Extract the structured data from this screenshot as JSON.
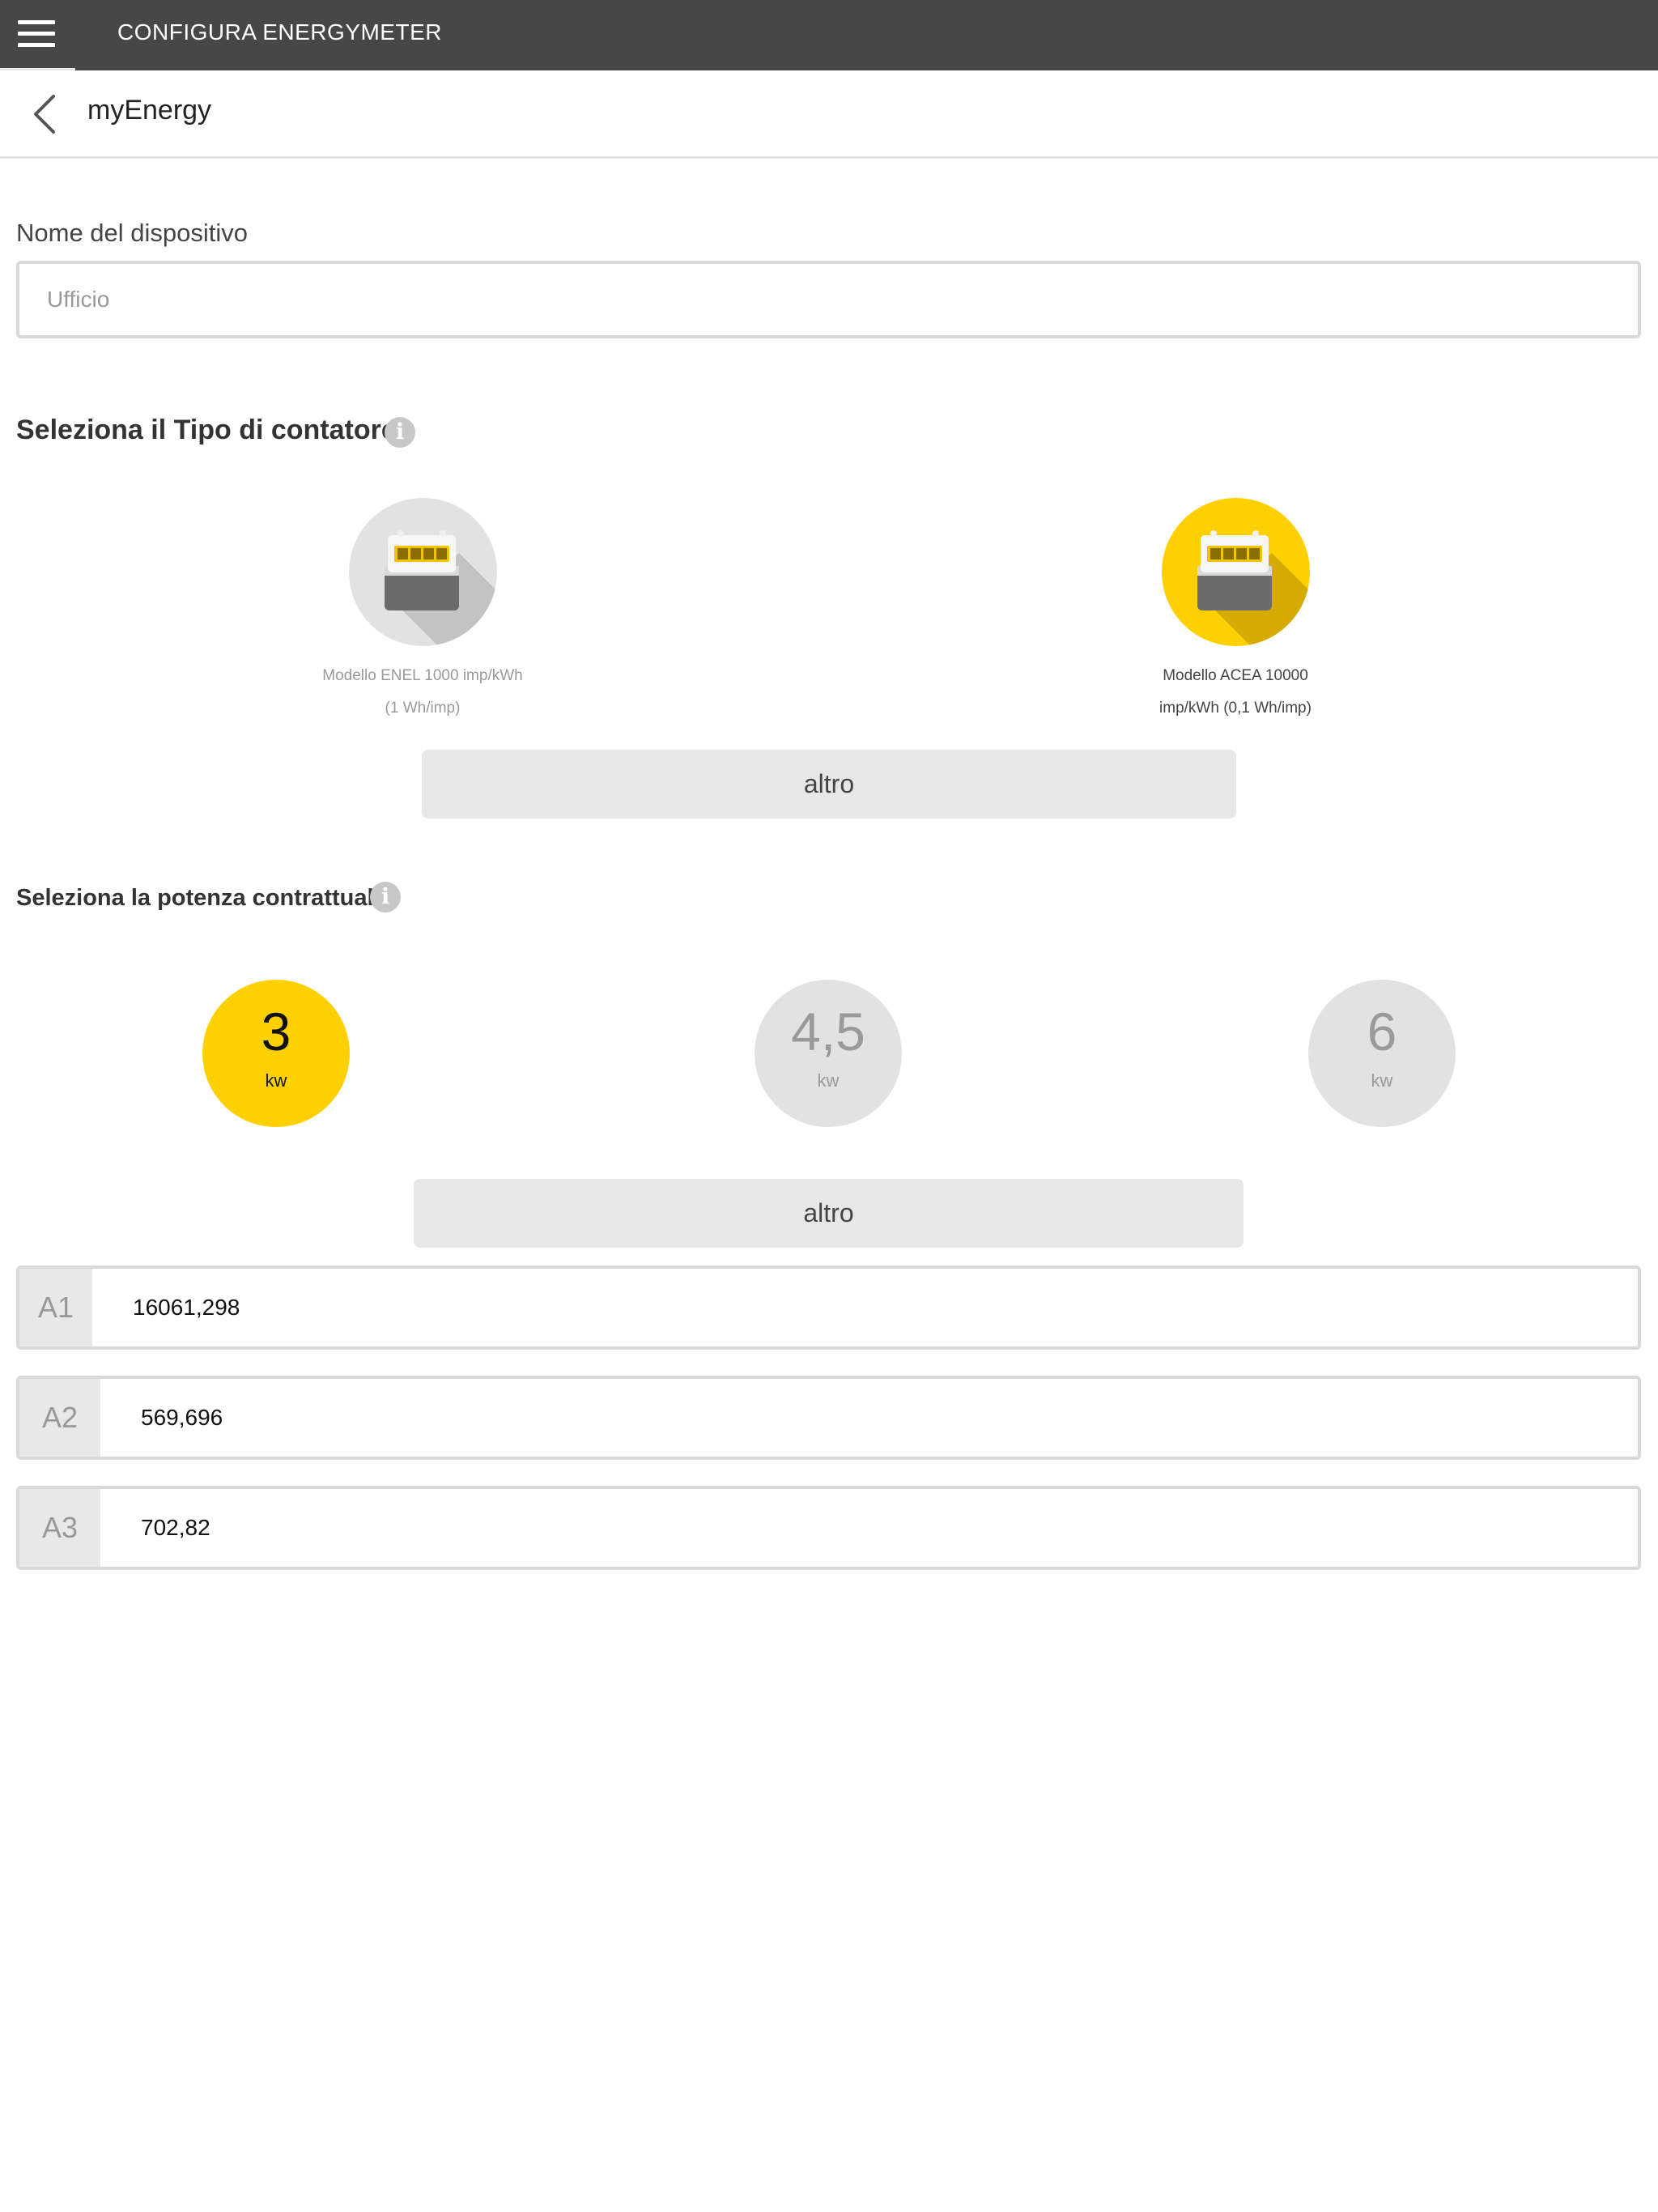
{
  "header": {
    "title": "CONFIGURA ENERGYMETER"
  },
  "subheader": {
    "title": "myEnergy"
  },
  "device": {
    "label": "Nome del dispositivo",
    "placeholder": "Ufficio",
    "value": ""
  },
  "meter_section": {
    "title": "Seleziona il Tipo di contatore",
    "options": [
      {
        "line1": "Modello ENEL 1000 imp/kWh",
        "line2": "(1 Wh/imp)",
        "selected": false,
        "digits": "2 3 5 6"
      },
      {
        "line1": "Modello ACEA 10000",
        "line2": "imp/kWh (0,1 Wh/imp)",
        "selected": true,
        "digits": "2 3 5 6"
      }
    ],
    "other_label": "altro"
  },
  "power_section": {
    "title": "Seleziona la potenza contrattuale",
    "options": [
      {
        "value": "3",
        "unit": "kw",
        "selected": true
      },
      {
        "value": "4,5",
        "unit": "kw",
        "selected": false
      },
      {
        "value": "6",
        "unit": "kw",
        "selected": false
      }
    ],
    "other_label": "altro"
  },
  "readings": [
    {
      "label": "A1",
      "value": "16061,298"
    },
    {
      "label": "A2",
      "value": "569,696"
    },
    {
      "label": "A3",
      "value": "702,82"
    }
  ],
  "colors": {
    "accent": "#ffd000",
    "topbar": "#474747",
    "inactive": "#e2e2e2"
  }
}
